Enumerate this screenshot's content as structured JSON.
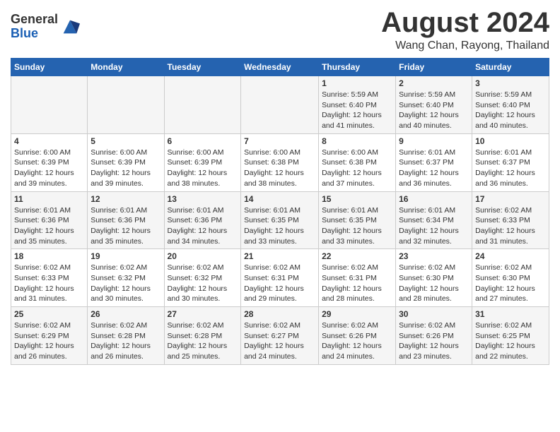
{
  "header": {
    "logo_general": "General",
    "logo_blue": "Blue",
    "month_title": "August 2024",
    "location": "Wang Chan, Rayong, Thailand"
  },
  "weekdays": [
    "Sunday",
    "Monday",
    "Tuesday",
    "Wednesday",
    "Thursday",
    "Friday",
    "Saturday"
  ],
  "weeks": [
    [
      {
        "day": "",
        "info": ""
      },
      {
        "day": "",
        "info": ""
      },
      {
        "day": "",
        "info": ""
      },
      {
        "day": "",
        "info": ""
      },
      {
        "day": "1",
        "info": "Sunrise: 5:59 AM\nSunset: 6:40 PM\nDaylight: 12 hours\nand 41 minutes."
      },
      {
        "day": "2",
        "info": "Sunrise: 5:59 AM\nSunset: 6:40 PM\nDaylight: 12 hours\nand 40 minutes."
      },
      {
        "day": "3",
        "info": "Sunrise: 5:59 AM\nSunset: 6:40 PM\nDaylight: 12 hours\nand 40 minutes."
      }
    ],
    [
      {
        "day": "4",
        "info": "Sunrise: 6:00 AM\nSunset: 6:39 PM\nDaylight: 12 hours\nand 39 minutes."
      },
      {
        "day": "5",
        "info": "Sunrise: 6:00 AM\nSunset: 6:39 PM\nDaylight: 12 hours\nand 39 minutes."
      },
      {
        "day": "6",
        "info": "Sunrise: 6:00 AM\nSunset: 6:39 PM\nDaylight: 12 hours\nand 38 minutes."
      },
      {
        "day": "7",
        "info": "Sunrise: 6:00 AM\nSunset: 6:38 PM\nDaylight: 12 hours\nand 38 minutes."
      },
      {
        "day": "8",
        "info": "Sunrise: 6:00 AM\nSunset: 6:38 PM\nDaylight: 12 hours\nand 37 minutes."
      },
      {
        "day": "9",
        "info": "Sunrise: 6:01 AM\nSunset: 6:37 PM\nDaylight: 12 hours\nand 36 minutes."
      },
      {
        "day": "10",
        "info": "Sunrise: 6:01 AM\nSunset: 6:37 PM\nDaylight: 12 hours\nand 36 minutes."
      }
    ],
    [
      {
        "day": "11",
        "info": "Sunrise: 6:01 AM\nSunset: 6:36 PM\nDaylight: 12 hours\nand 35 minutes."
      },
      {
        "day": "12",
        "info": "Sunrise: 6:01 AM\nSunset: 6:36 PM\nDaylight: 12 hours\nand 35 minutes."
      },
      {
        "day": "13",
        "info": "Sunrise: 6:01 AM\nSunset: 6:36 PM\nDaylight: 12 hours\nand 34 minutes."
      },
      {
        "day": "14",
        "info": "Sunrise: 6:01 AM\nSunset: 6:35 PM\nDaylight: 12 hours\nand 33 minutes."
      },
      {
        "day": "15",
        "info": "Sunrise: 6:01 AM\nSunset: 6:35 PM\nDaylight: 12 hours\nand 33 minutes."
      },
      {
        "day": "16",
        "info": "Sunrise: 6:01 AM\nSunset: 6:34 PM\nDaylight: 12 hours\nand 32 minutes."
      },
      {
        "day": "17",
        "info": "Sunrise: 6:02 AM\nSunset: 6:33 PM\nDaylight: 12 hours\nand 31 minutes."
      }
    ],
    [
      {
        "day": "18",
        "info": "Sunrise: 6:02 AM\nSunset: 6:33 PM\nDaylight: 12 hours\nand 31 minutes."
      },
      {
        "day": "19",
        "info": "Sunrise: 6:02 AM\nSunset: 6:32 PM\nDaylight: 12 hours\nand 30 minutes."
      },
      {
        "day": "20",
        "info": "Sunrise: 6:02 AM\nSunset: 6:32 PM\nDaylight: 12 hours\nand 30 minutes."
      },
      {
        "day": "21",
        "info": "Sunrise: 6:02 AM\nSunset: 6:31 PM\nDaylight: 12 hours\nand 29 minutes."
      },
      {
        "day": "22",
        "info": "Sunrise: 6:02 AM\nSunset: 6:31 PM\nDaylight: 12 hours\nand 28 minutes."
      },
      {
        "day": "23",
        "info": "Sunrise: 6:02 AM\nSunset: 6:30 PM\nDaylight: 12 hours\nand 28 minutes."
      },
      {
        "day": "24",
        "info": "Sunrise: 6:02 AM\nSunset: 6:30 PM\nDaylight: 12 hours\nand 27 minutes."
      }
    ],
    [
      {
        "day": "25",
        "info": "Sunrise: 6:02 AM\nSunset: 6:29 PM\nDaylight: 12 hours\nand 26 minutes."
      },
      {
        "day": "26",
        "info": "Sunrise: 6:02 AM\nSunset: 6:28 PM\nDaylight: 12 hours\nand 26 minutes."
      },
      {
        "day": "27",
        "info": "Sunrise: 6:02 AM\nSunset: 6:28 PM\nDaylight: 12 hours\nand 25 minutes."
      },
      {
        "day": "28",
        "info": "Sunrise: 6:02 AM\nSunset: 6:27 PM\nDaylight: 12 hours\nand 24 minutes."
      },
      {
        "day": "29",
        "info": "Sunrise: 6:02 AM\nSunset: 6:26 PM\nDaylight: 12 hours\nand 24 minutes."
      },
      {
        "day": "30",
        "info": "Sunrise: 6:02 AM\nSunset: 6:26 PM\nDaylight: 12 hours\nand 23 minutes."
      },
      {
        "day": "31",
        "info": "Sunrise: 6:02 AM\nSunset: 6:25 PM\nDaylight: 12 hours\nand 22 minutes."
      }
    ]
  ]
}
